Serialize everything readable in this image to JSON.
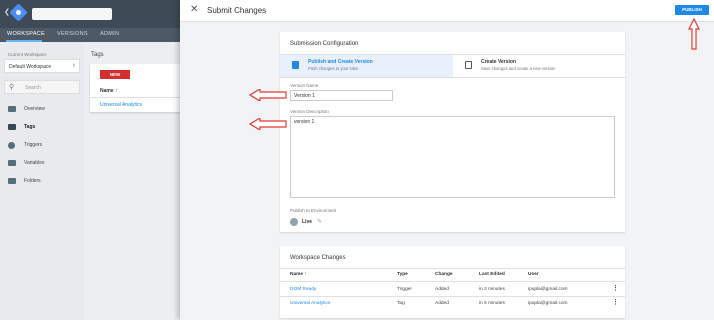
{
  "bg": {
    "nav_tabs": [
      "WORKSPACE",
      "VERSIONS",
      "ADMIN"
    ],
    "current_workspace_label": "Current Workspace",
    "workspace_name": "Default Workspace",
    "search_placeholder": "Search",
    "sidebar_items": [
      {
        "label": "Overview",
        "icon": "overview-icon"
      },
      {
        "label": "Tags",
        "icon": "tag-icon"
      },
      {
        "label": "Triggers",
        "icon": "trigger-icon"
      },
      {
        "label": "Variables",
        "icon": "variable-icon"
      },
      {
        "label": "Folders",
        "icon": "folder-icon"
      }
    ],
    "tags_title": "Tags",
    "new_button": "NEW",
    "tags_col_name": "Name",
    "tags_row": "Universal Analytics"
  },
  "dialog": {
    "title": "Submit Changes",
    "publish_button": "PUBLISH",
    "config": {
      "title": "Submission Configuration",
      "options": [
        {
          "title": "Publish and Create Version",
          "subtitle": "Push changes to your sites",
          "selected": true
        },
        {
          "title": "Create Version",
          "subtitle": "Save changes and create a new version",
          "selected": false
        }
      ],
      "version_name_label": "Version Name",
      "version_name_value": "Version 1",
      "version_desc_label": "Version Description",
      "version_desc_value": "version 1",
      "env_label": "Publish to Environment",
      "env_value": "Live"
    },
    "changes": {
      "title": "Workspace Changes",
      "columns": [
        "Name",
        "Type",
        "Change",
        "Last Edited",
        "User"
      ],
      "rows": [
        {
          "name": "DOM Ready",
          "type": "Trigger",
          "change": "Added",
          "last_edited": "in 2 minutes",
          "user": "ipupla@gmail.com"
        },
        {
          "name": "Universal Analytics",
          "type": "Tag",
          "change": "Added",
          "last_edited": "in 5 minutes",
          "user": "ipupla@gmail.com"
        }
      ]
    }
  },
  "colors": {
    "accent": "#1e88e5",
    "annotation_arrow": "#e53935",
    "new_button": "#d32f2f"
  }
}
